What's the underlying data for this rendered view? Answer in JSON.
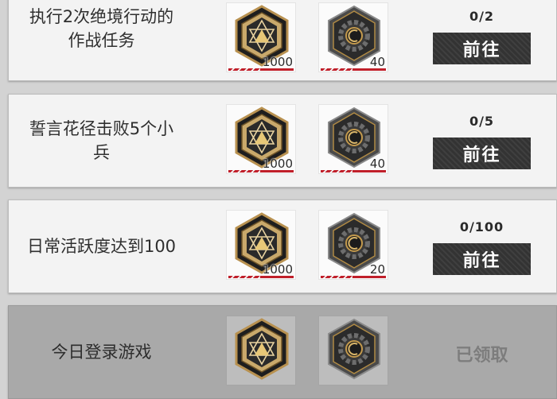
{
  "tasks": [
    {
      "title": "执行2次绝境行动的\n作战任务",
      "progress": "0/2",
      "action_label": "前往",
      "rewards": [
        {
          "icon": "gold-hexagram-medal-icon",
          "quantity": "1000"
        },
        {
          "icon": "dark-gear-token-icon",
          "quantity": "40"
        }
      ]
    },
    {
      "title": "誓言花径击败5个小\n兵",
      "progress": "0/5",
      "action_label": "前往",
      "rewards": [
        {
          "icon": "gold-hexagram-medal-icon",
          "quantity": "1000"
        },
        {
          "icon": "dark-gear-token-icon",
          "quantity": "40"
        }
      ]
    },
    {
      "title": "日常活跃度达到100",
      "progress": "0/100",
      "action_label": "前往",
      "rewards": [
        {
          "icon": "gold-hexagram-medal-icon",
          "quantity": "1000"
        },
        {
          "icon": "dark-gear-token-icon",
          "quantity": "20"
        }
      ]
    },
    {
      "title": "今日登录游戏",
      "status_label": "已领取",
      "rewards": [
        {
          "icon": "gold-hexagram-medal-icon"
        },
        {
          "icon": "dark-gear-token-icon"
        }
      ]
    }
  ]
}
